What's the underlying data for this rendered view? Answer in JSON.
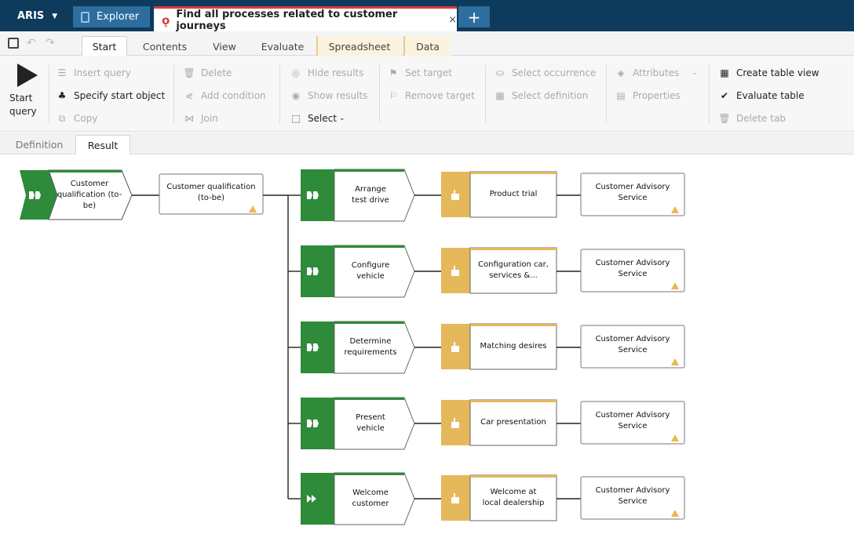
{
  "titlebar": {
    "app_menu": "ARIS",
    "tabs": [
      {
        "label": "Explorer"
      },
      {
        "label": "Find all processes related to customer journeys"
      }
    ],
    "close_glyph": "×",
    "add_tab_glyph": "+"
  },
  "ribbon_tabs": [
    "Start",
    "Contents",
    "View",
    "Evaluate",
    "Spreadsheet",
    "Data"
  ],
  "ribbon": {
    "start_query": [
      "Start",
      "query"
    ],
    "insert_query": "Insert query",
    "specify_start_object": "Specify start object",
    "copy": "Copy",
    "delete": "Delete",
    "add_condition": "Add condition",
    "join": "Join",
    "hide_results": "Hide results",
    "show_results": "Show results",
    "select": "Select",
    "set_target": "Set target",
    "remove_target": "Remove target",
    "select_occurrence": "Select occurrence",
    "select_definition": "Select definition",
    "attributes": "Attributes",
    "properties": "Properties",
    "create_table_view": "Create table view",
    "evaluate_table": "Evaluate table",
    "delete_tab": "Delete tab"
  },
  "subtabs": [
    "Definition",
    "Result"
  ],
  "diagram": {
    "start": {
      "lines": [
        "Customer",
        "qualification (to-",
        "be)"
      ]
    },
    "function": {
      "lines": [
        "Customer qualification",
        "(to-be)"
      ]
    },
    "rows": [
      {
        "process": [
          "Arrange",
          "test drive"
        ],
        "touchpoint": [
          "Product trial"
        ],
        "service": [
          "Customer Advisory",
          "Service"
        ],
        "icon": "process-interface-icon"
      },
      {
        "process": [
          "Configure",
          "vehicle"
        ],
        "touchpoint": [
          "Configuration car,",
          "services &..."
        ],
        "service": [
          "Customer Advisory",
          "Service"
        ],
        "icon": "process-interface-icon"
      },
      {
        "process": [
          "Determine",
          "requirements"
        ],
        "touchpoint": [
          "Matching desires"
        ],
        "service": [
          "Customer Advisory",
          "Service"
        ],
        "icon": "process-interface-icon"
      },
      {
        "process": [
          "Present",
          "vehicle"
        ],
        "touchpoint": [
          "Car presentation"
        ],
        "service": [
          "Customer Advisory",
          "Service"
        ],
        "icon": "process-interface-icon"
      },
      {
        "process": [
          "Welcome",
          "customer"
        ],
        "touchpoint": [
          "Welcome at",
          "local dealership"
        ],
        "service": [
          "Customer Advisory",
          "Service"
        ],
        "icon": "fast-forward-icon"
      }
    ]
  },
  "colors": {
    "green": "#2e8b3a",
    "gold": "#e5b85c",
    "navy": "#0e3a5c",
    "tab_blue": "#2d6e9e",
    "red": "#d83b3b",
    "warning": "#e9b949"
  }
}
